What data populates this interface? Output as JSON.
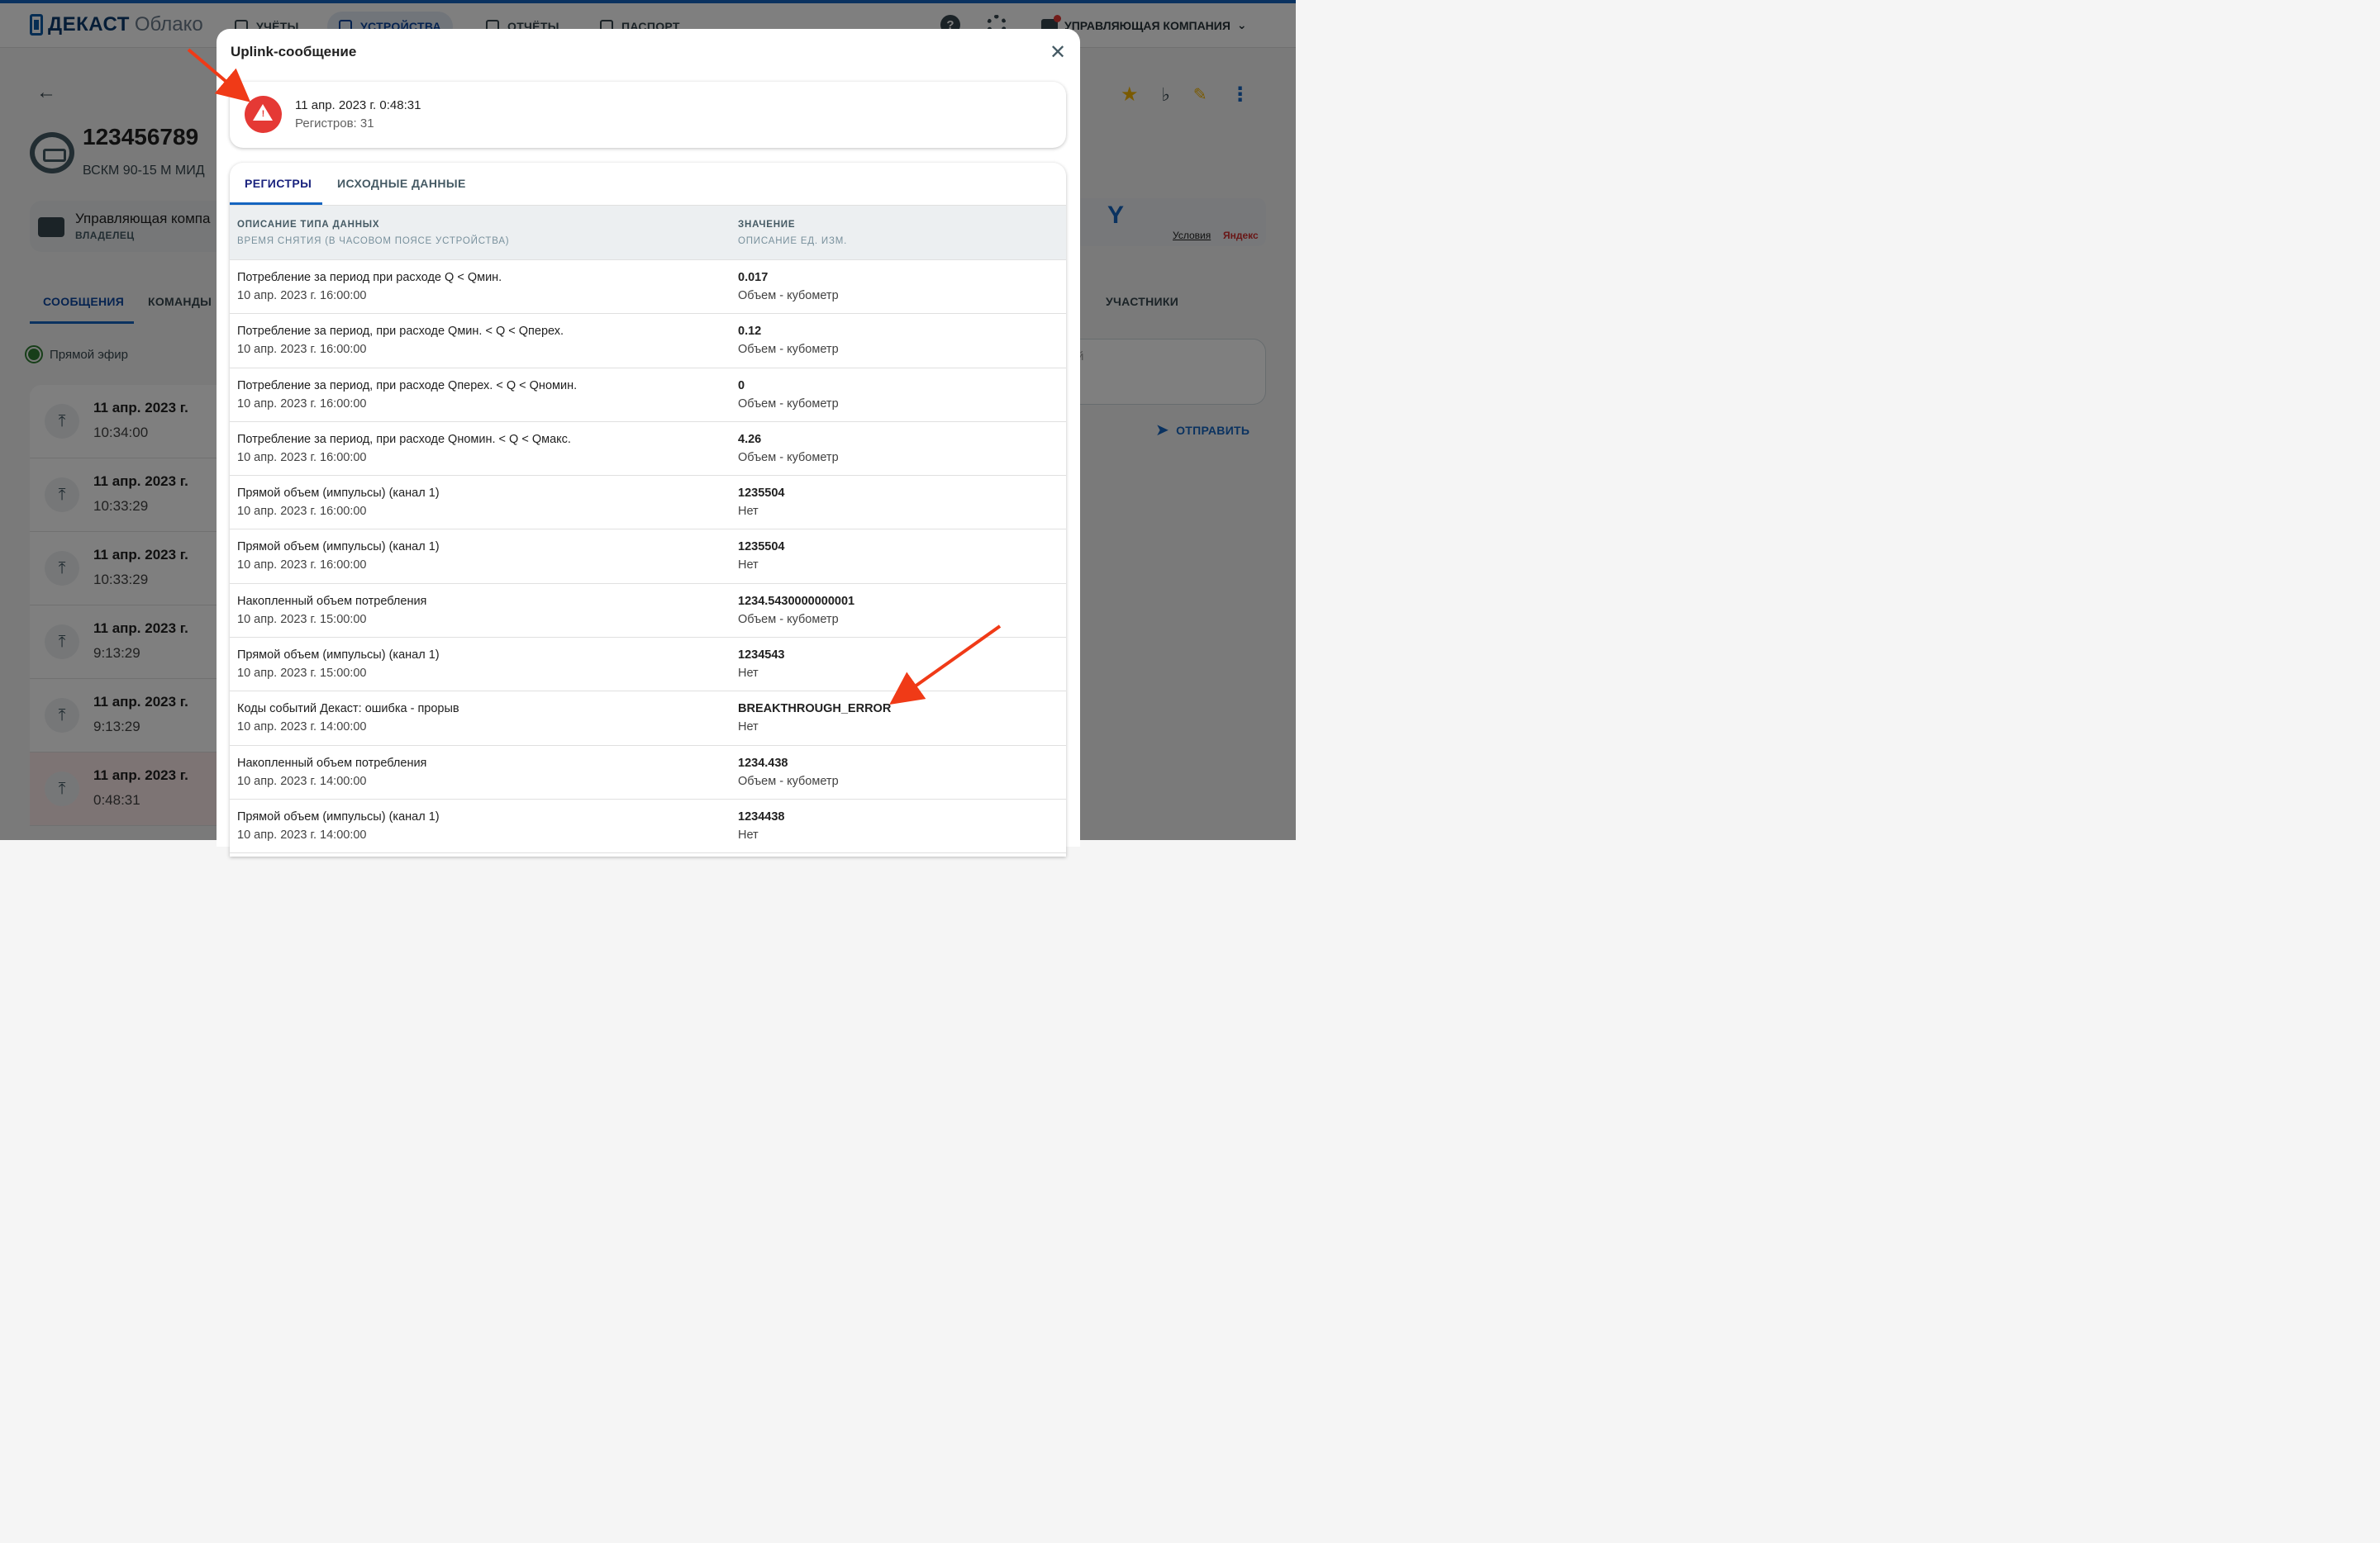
{
  "app": {
    "brand": "ДЕКАСТ",
    "brand_sub": "Облако",
    "nav": [
      {
        "label": "УЧЁТЫ",
        "icon": "gauge-icon"
      },
      {
        "label": "УСТРОЙСТВА",
        "icon": "device-icon"
      },
      {
        "label": "ОТЧЁТЫ",
        "icon": "report-icon"
      },
      {
        "label": "ПАСПОРТ",
        "icon": "passport-icon"
      }
    ],
    "help_glyph": "?",
    "company": "УПРАВЛЯЮЩАЯ КОМПАНИЯ"
  },
  "device": {
    "id": "123456789",
    "model": "ВСКМ 90-15 М МИД",
    "owner_name": "Управляющая компа",
    "owner_role": "ВЛАДЕЛЕЦ",
    "tabs": [
      "СООБЩЕНИЯ",
      "КОМАНДЫ"
    ],
    "participants_tab": "УЧАСТНИКИ",
    "live_label": "Прямой эфир",
    "input_placeholder": "й",
    "send_label": "ОТПРАВИТЬ",
    "map_terms": "Условия",
    "map_brand": "Яндекс",
    "messages": [
      {
        "date": "11 апр. 2023 г.",
        "time": "10:34:00"
      },
      {
        "date": "11 апр. 2023 г.",
        "time": "10:33:29"
      },
      {
        "date": "11 апр. 2023 г.",
        "time": "10:33:29"
      },
      {
        "date": "11 апр. 2023 г.",
        "time": "9:13:29"
      },
      {
        "date": "11 апр. 2023 г.",
        "time": "9:13:29"
      },
      {
        "date": "11 апр. 2023 г.",
        "time": "0:48:31"
      }
    ]
  },
  "dialog": {
    "title": "Uplink-сообщение",
    "summary": {
      "datetime": "11 апр. 2023 г. 0:48:31",
      "registers": "Регистров: 31"
    },
    "tabs": [
      "РЕГИСТРЫ",
      "ИСХОДНЫЕ ДАННЫЕ"
    ],
    "columns": {
      "col1_title": "ОПИСАНИЕ ТИПА ДАННЫХ",
      "col1_sub": "ВРЕМЯ СНЯТИЯ (В ЧАСОВОМ ПОЯСЕ УСТРОЙСТВА)",
      "col2_title": "ЗНАЧЕНИЕ",
      "col2_sub": "ОПИСАНИЕ ЕД. ИЗМ."
    },
    "rows": [
      {
        "desc": "Потребление за период при расходе Q < Qмин.",
        "time": "10 апр. 2023 г. 16:00:00",
        "value": "0.017",
        "unit": "Объем - кубометр"
      },
      {
        "desc": "Потребление за период, при расходе Qмин. < Q < Qперех.",
        "time": "10 апр. 2023 г. 16:00:00",
        "value": "0.12",
        "unit": "Объем - кубометр"
      },
      {
        "desc": "Потребление за период, при расходе Qперех. < Q < Qномин.",
        "time": "10 апр. 2023 г. 16:00:00",
        "value": "0",
        "unit": "Объем - кубометр"
      },
      {
        "desc": "Потребление за период, при расходе Qномин. < Q < Qмакс.",
        "time": "10 апр. 2023 г. 16:00:00",
        "value": "4.26",
        "unit": "Объем - кубометр"
      },
      {
        "desc": "Прямой объем (импульсы) (канал 1)",
        "time": "10 апр. 2023 г. 16:00:00",
        "value": "1235504",
        "unit": "Нет"
      },
      {
        "desc": "Прямой объем (импульсы) (канал 1)",
        "time": "10 апр. 2023 г. 16:00:00",
        "value": "1235504",
        "unit": "Нет"
      },
      {
        "desc": "Накопленный объем потребления",
        "time": "10 апр. 2023 г. 15:00:00",
        "value": "1234.5430000000001",
        "unit": "Объем - кубометр"
      },
      {
        "desc": "Прямой объем (импульсы) (канал 1)",
        "time": "10 апр. 2023 г. 15:00:00",
        "value": "1234543",
        "unit": "Нет"
      },
      {
        "desc": "Коды событий Декаст: ошибка - прорыв",
        "time": "10 апр. 2023 г. 14:00:00",
        "value": "BREAKTHROUGH_ERROR",
        "unit": "Нет"
      },
      {
        "desc": "Накопленный объем потребления",
        "time": "10 апр. 2023 г. 14:00:00",
        "value": "1234.438",
        "unit": "Объем - кубометр"
      },
      {
        "desc": "Прямой объем (импульсы) (канал 1)",
        "time": "10 апр. 2023 г. 14:00:00",
        "value": "1234438",
        "unit": "Нет"
      }
    ]
  },
  "colors": {
    "accent": "#1565c0",
    "warning": "#e53935",
    "annotation": "#f03a17"
  }
}
